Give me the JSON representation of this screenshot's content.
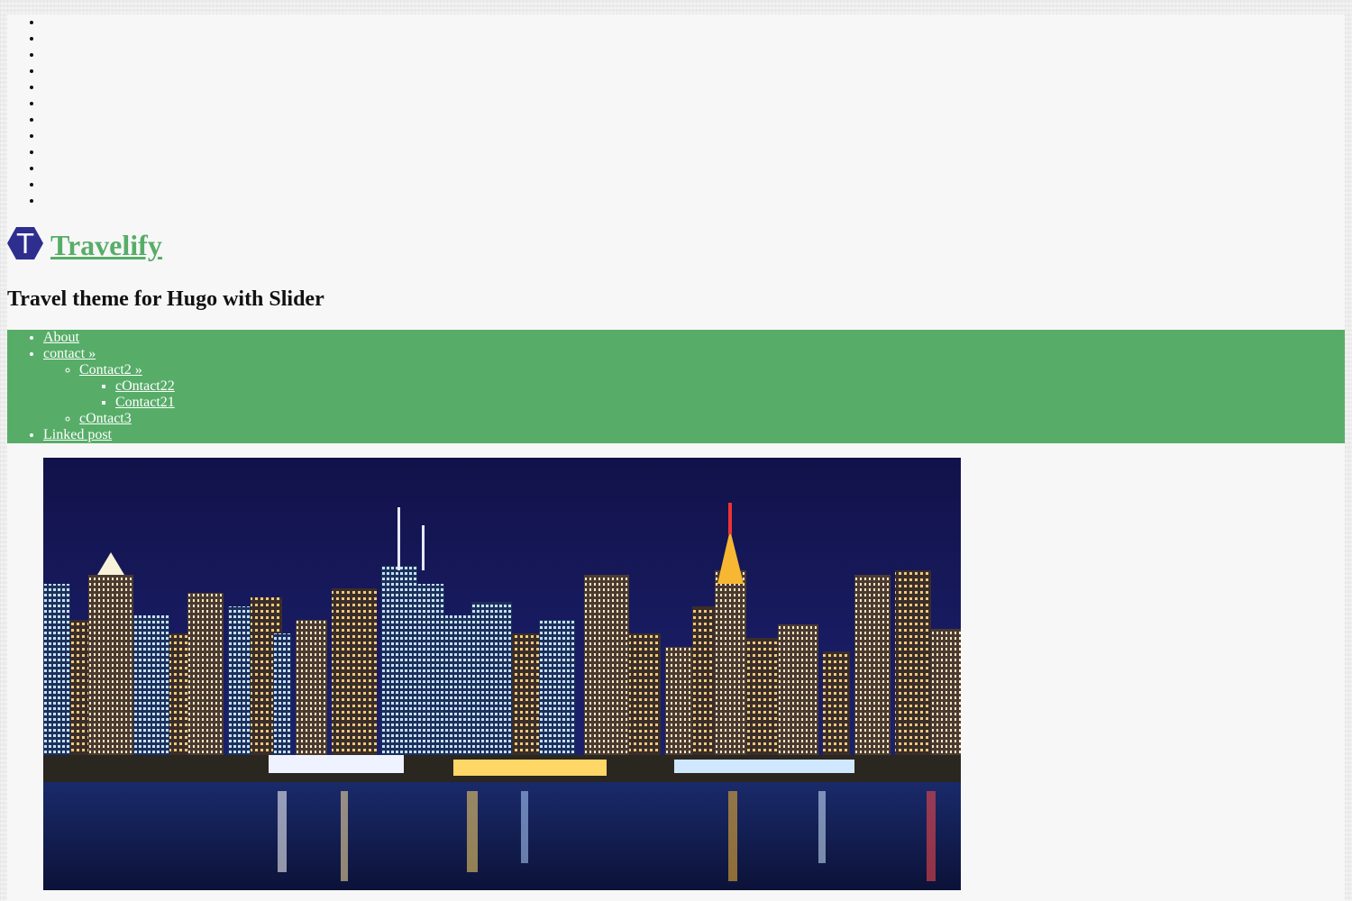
{
  "site": {
    "title": "Travelify",
    "logo_letter": "T",
    "description": "Travel theme for Hugo with Slider"
  },
  "social_icons": [
    "icon-1",
    "icon-2",
    "icon-3",
    "icon-4",
    "icon-5",
    "icon-6",
    "icon-7",
    "icon-8",
    "icon-9",
    "icon-10",
    "icon-11",
    "icon-12"
  ],
  "nav": {
    "about": "About",
    "contact": "contact »",
    "contact2": "Contact2 »",
    "contact22": "cOntact22",
    "contact21": "Contact21",
    "contact3": "cOntact3",
    "linked_post": "Linked post"
  },
  "colors": {
    "accent": "#57ad68",
    "logo_fill": "#2e2e8f"
  }
}
